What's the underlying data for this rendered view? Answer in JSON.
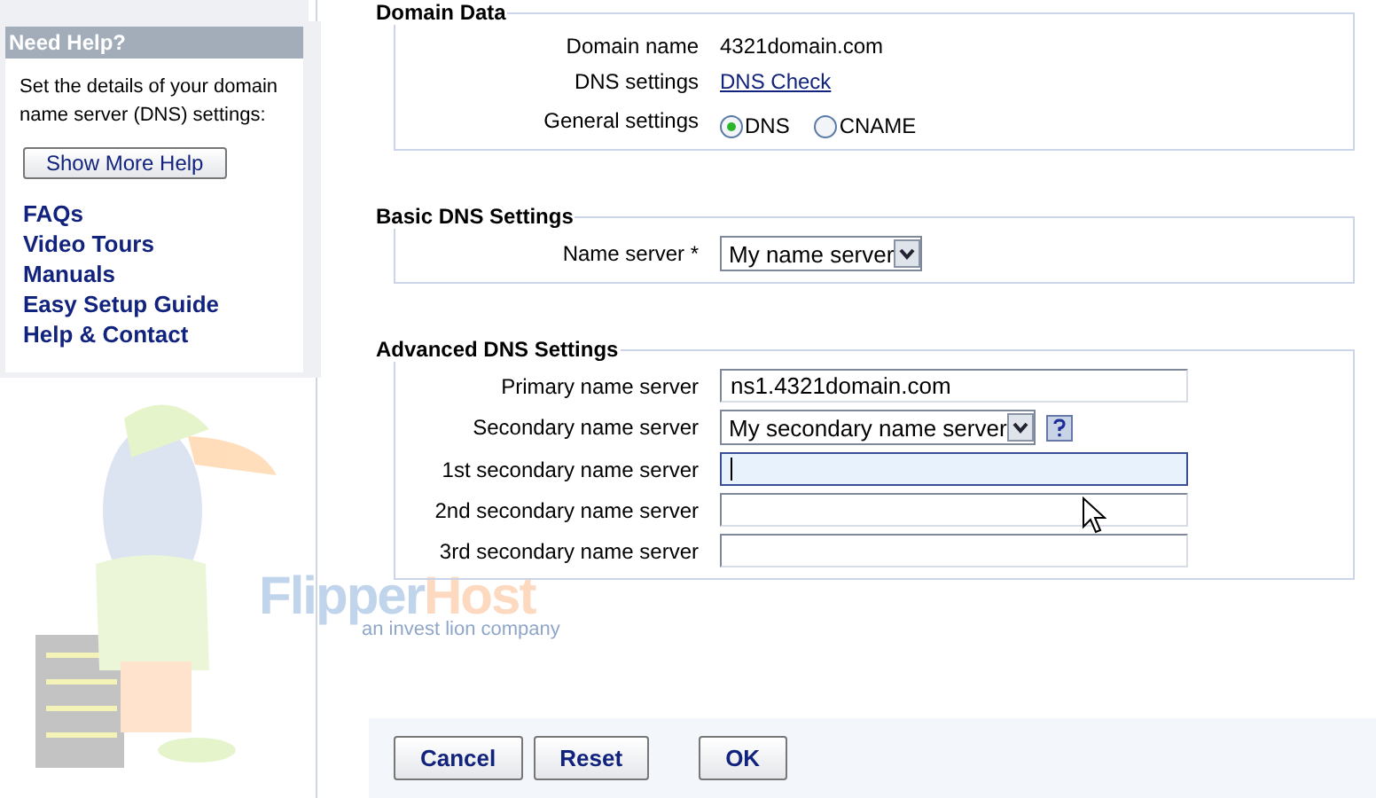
{
  "help_panel": {
    "title": "Need Help?",
    "text": "Set the details of your domain name server (DNS) settings:",
    "button": "Show More Help",
    "links": [
      "FAQs",
      "Video Tours",
      "Manuals",
      "Easy Setup Guide",
      "Help & Contact"
    ]
  },
  "logo": {
    "part_1": "Flipper",
    "part_2": "Host",
    "tagline": "an invest lion company"
  },
  "sections": [
    {
      "title": "Domain Data",
      "rows": [
        {
          "kind": "text",
          "label": "Domain name",
          "value": "4321domain.com"
        },
        {
          "kind": "link",
          "label": "DNS settings",
          "value": "DNS Check"
        },
        {
          "kind": "radio",
          "label": "General settings",
          "options": [
            {
              "label": "DNS",
              "selected": true
            },
            {
              "label": "CNAME",
              "selected": false
            }
          ]
        }
      ]
    },
    {
      "title": "Basic DNS Settings",
      "rows": [
        {
          "kind": "select",
          "label": "Name server *",
          "value": "My name server"
        }
      ]
    },
    {
      "title": "Advanced DNS Settings",
      "rows": [
        {
          "kind": "input",
          "label": "Primary name server",
          "value": "ns1.4321domain.com",
          "focused": false
        },
        {
          "kind": "select",
          "label": "Secondary name server",
          "value": "My secondary name server",
          "help": true
        },
        {
          "kind": "input",
          "label": "1st secondary name server",
          "value": "",
          "focused": true
        },
        {
          "kind": "input",
          "label": "2nd secondary name server",
          "value": "",
          "focused": false
        },
        {
          "kind": "input",
          "label": "3rd secondary name server",
          "value": "",
          "focused": false
        }
      ]
    }
  ],
  "buttons": [
    "Cancel",
    "Reset",
    "OK"
  ]
}
